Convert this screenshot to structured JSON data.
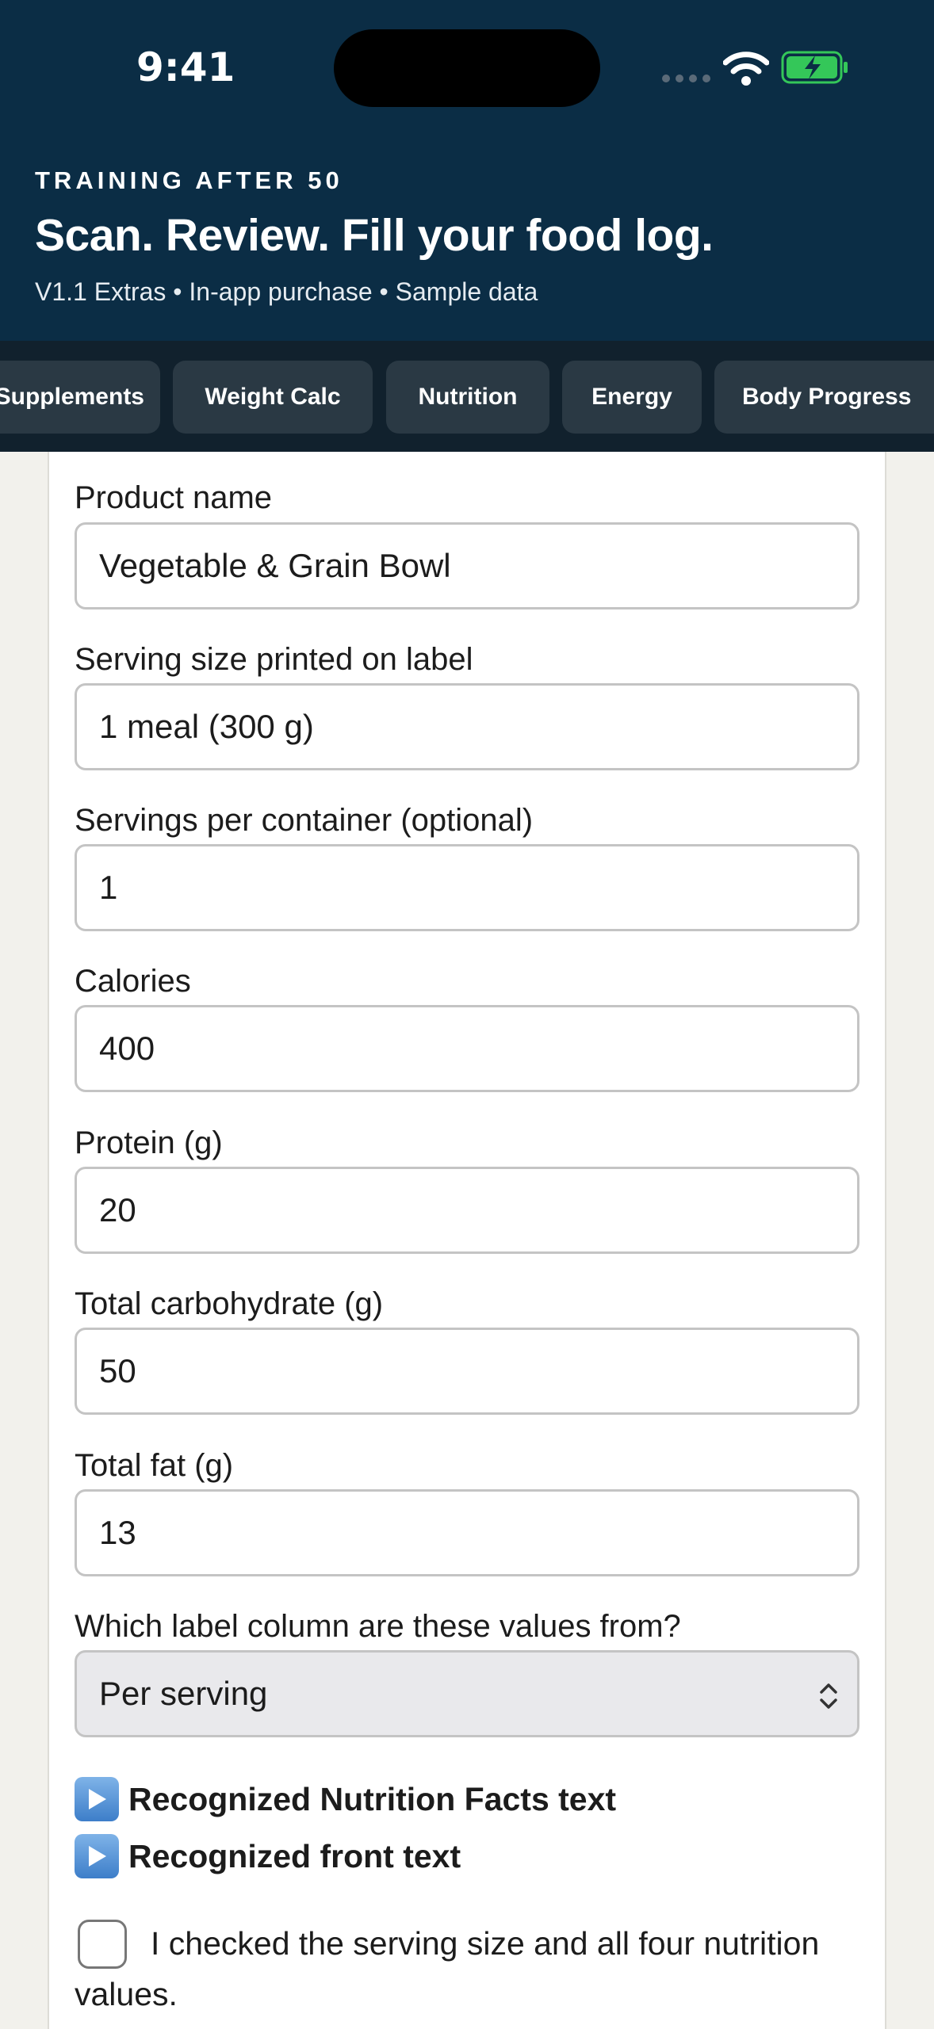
{
  "status_bar": {
    "time": "9:41"
  },
  "header": {
    "eyebrow": "TRAINING AFTER 50",
    "title": "Scan. Review. Fill your food log.",
    "subtitle": "V1.1 Extras • In-app purchase • Sample data"
  },
  "tabs": [
    {
      "label": "Supplements"
    },
    {
      "label": "Weight Calc"
    },
    {
      "label": "Nutrition"
    },
    {
      "label": "Energy"
    },
    {
      "label": "Body Progress"
    }
  ],
  "form": {
    "product_name": {
      "label": "Product name",
      "value": "Vegetable & Grain Bowl"
    },
    "serving_size": {
      "label": "Serving size printed on label",
      "value": "1 meal (300 g)"
    },
    "servings_per_container": {
      "label": "Servings per container (optional)",
      "value": "1"
    },
    "calories": {
      "label": "Calories",
      "value": "400"
    },
    "protein": {
      "label": "Protein (g)",
      "value": "20"
    },
    "carbohydrate": {
      "label": "Total carbohydrate (g)",
      "value": "50"
    },
    "fat": {
      "label": "Total fat (g)",
      "value": "13"
    },
    "column": {
      "label": "Which label column are these values from?",
      "selected": "Per serving"
    },
    "recognized_nutrition": "Recognized Nutrition Facts text",
    "recognized_front": "Recognized front text",
    "confirm_checkbox": {
      "label": "I checked the serving size and all four nutrition values.",
      "checked": false
    }
  },
  "colors": {
    "header_bg": "#0b2d45",
    "tabbar_bg": "#11212d",
    "tab_bg": "#2a3944",
    "battery_green": "#34c759"
  }
}
